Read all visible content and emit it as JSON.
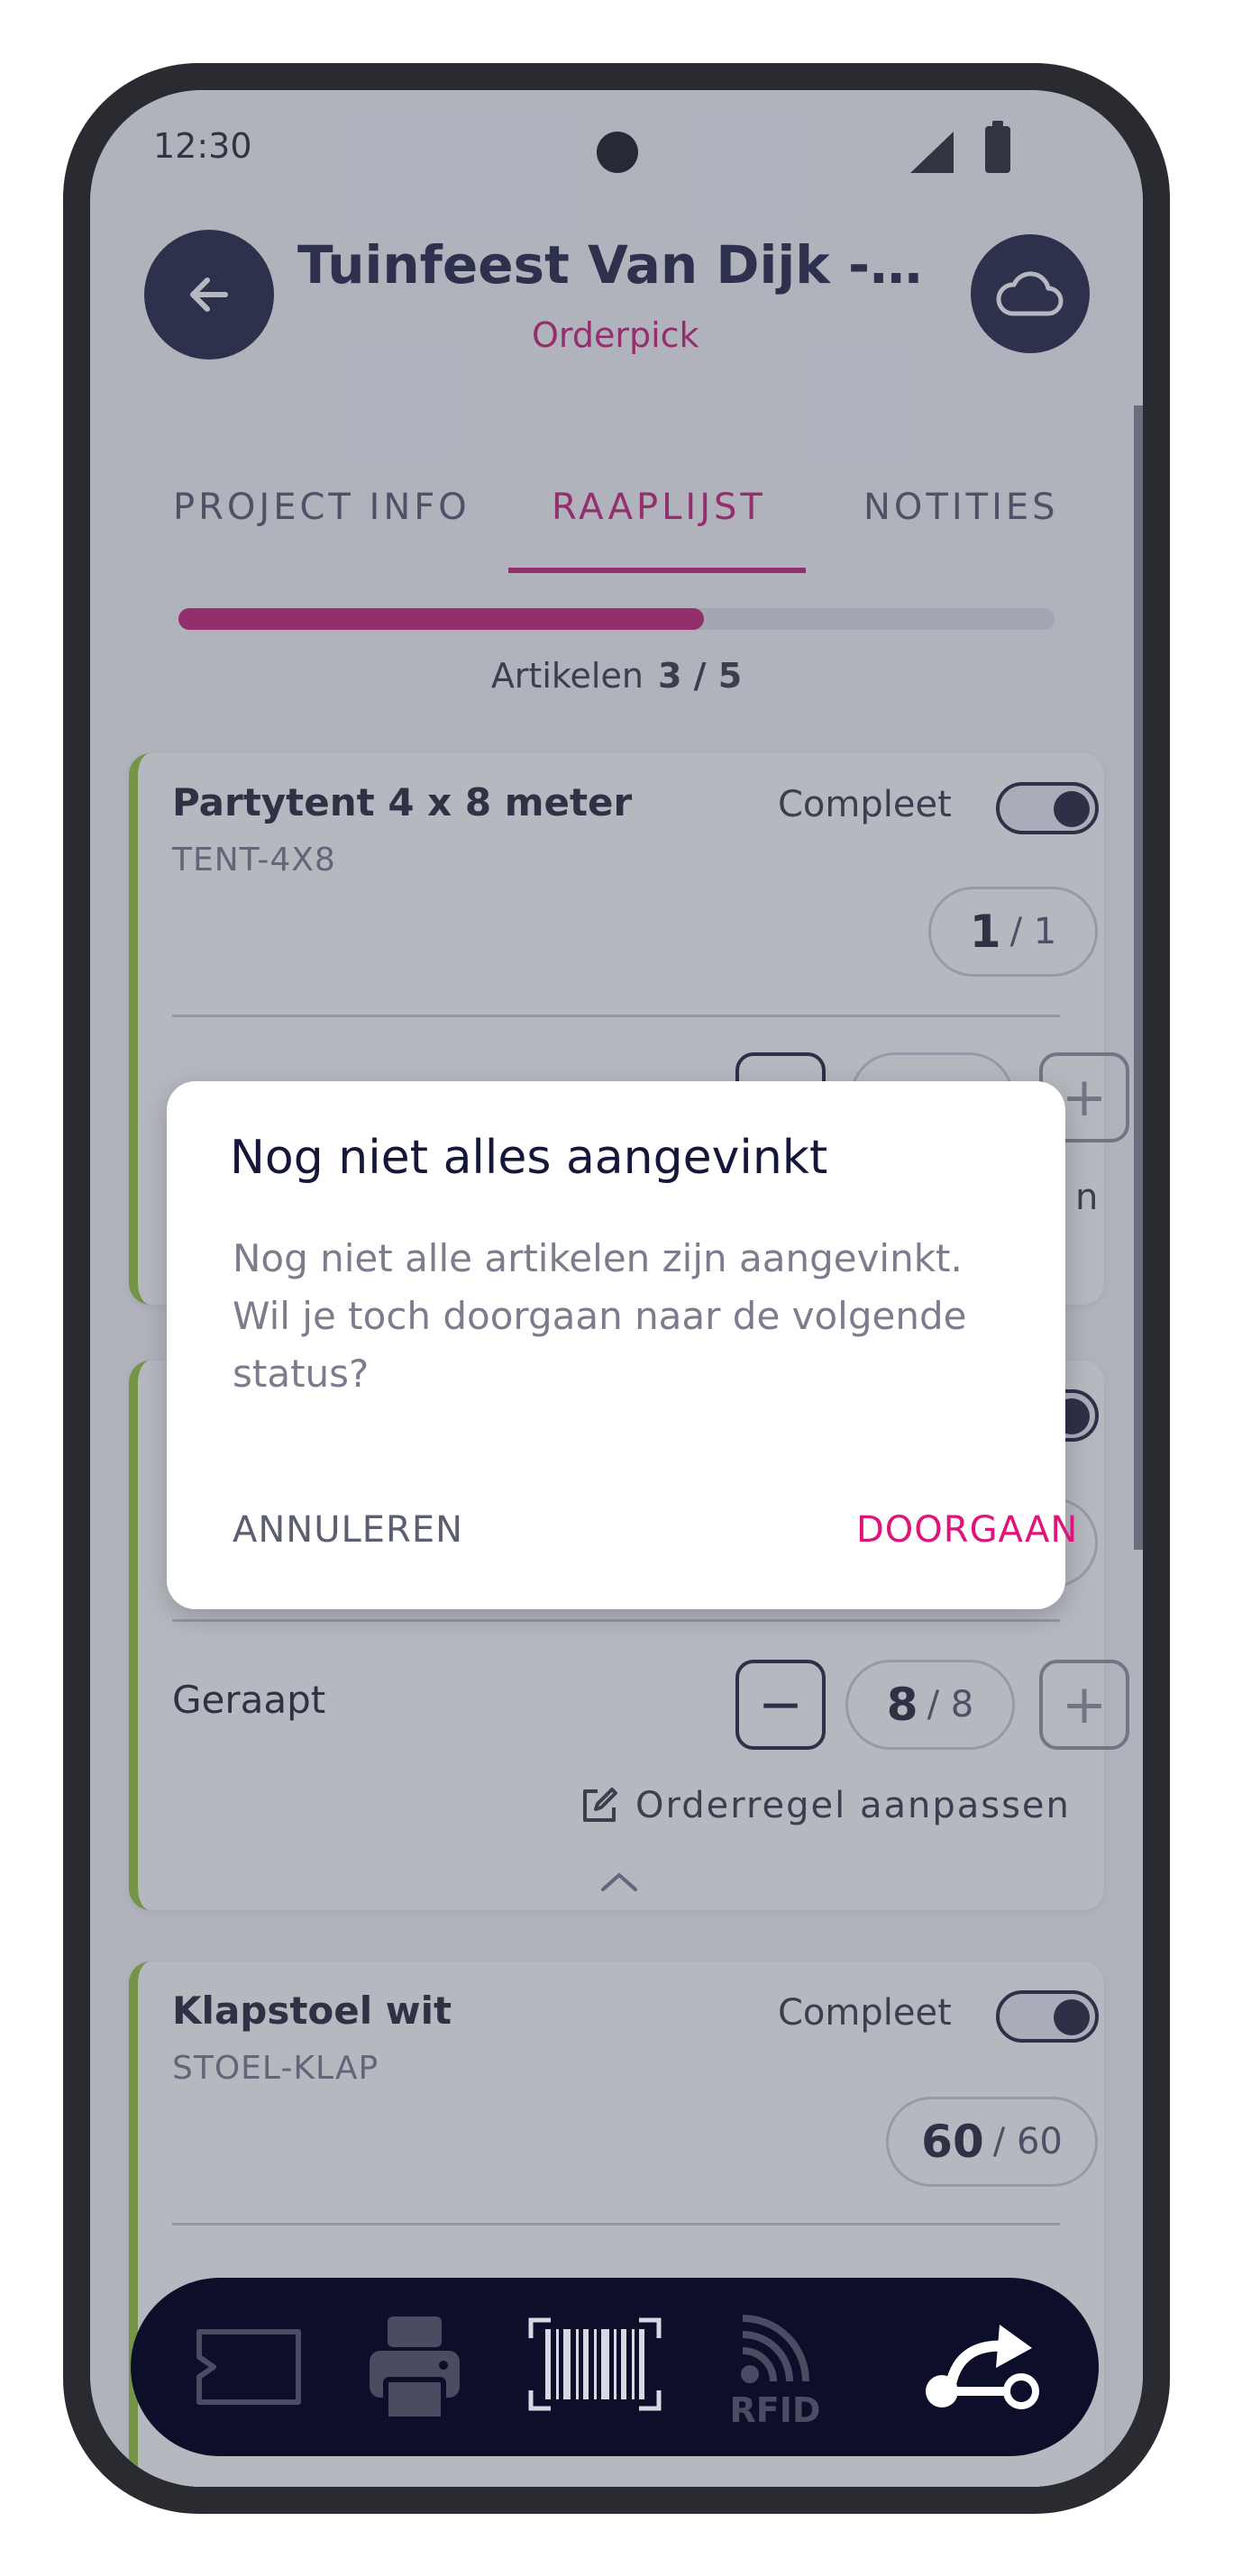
{
  "status_bar": {
    "time": "12:30"
  },
  "header": {
    "title": "Tuinfeest Van Dijk -…",
    "subtitle": "Orderpick"
  },
  "tabs": [
    {
      "label": "PROJECT INFO",
      "active": false
    },
    {
      "label": "RAAPLIJST",
      "active": true
    },
    {
      "label": "NOTITIES",
      "active": false
    }
  ],
  "progress": {
    "label": "Artikelen",
    "value_text": "3 / 5",
    "fraction": 0.6
  },
  "cards": [
    {
      "name": "Partytent 4 x 8 meter",
      "sku": "TENT-4X8",
      "compleet_label": "Compleet",
      "picked": "1",
      "total": "/ 1",
      "edit_tail": "n"
    },
    {
      "geraapt_label": "Geraapt",
      "picked": "8",
      "total": "/ 8",
      "edit_label": "Orderregel aanpassen"
    },
    {
      "name": "Klapstoel wit",
      "sku": "STOEL-KLAP",
      "compleet_label": "Compleet",
      "picked": "60",
      "total": "/ 60"
    }
  ],
  "dialog": {
    "title": "Nog niet alles aangevinkt",
    "message": "Nog niet alle artikelen zijn aangevinkt. Wil je toch doorgaan naar de volgende status?",
    "cancel_label": "ANNULEREN",
    "confirm_label": "DOORGAAN"
  },
  "bottom_bar": {
    "rfid_label": "RFID"
  },
  "colors": {
    "accent": "#c2146e",
    "navy": "#131737",
    "complete_green": "#8fc22f"
  }
}
